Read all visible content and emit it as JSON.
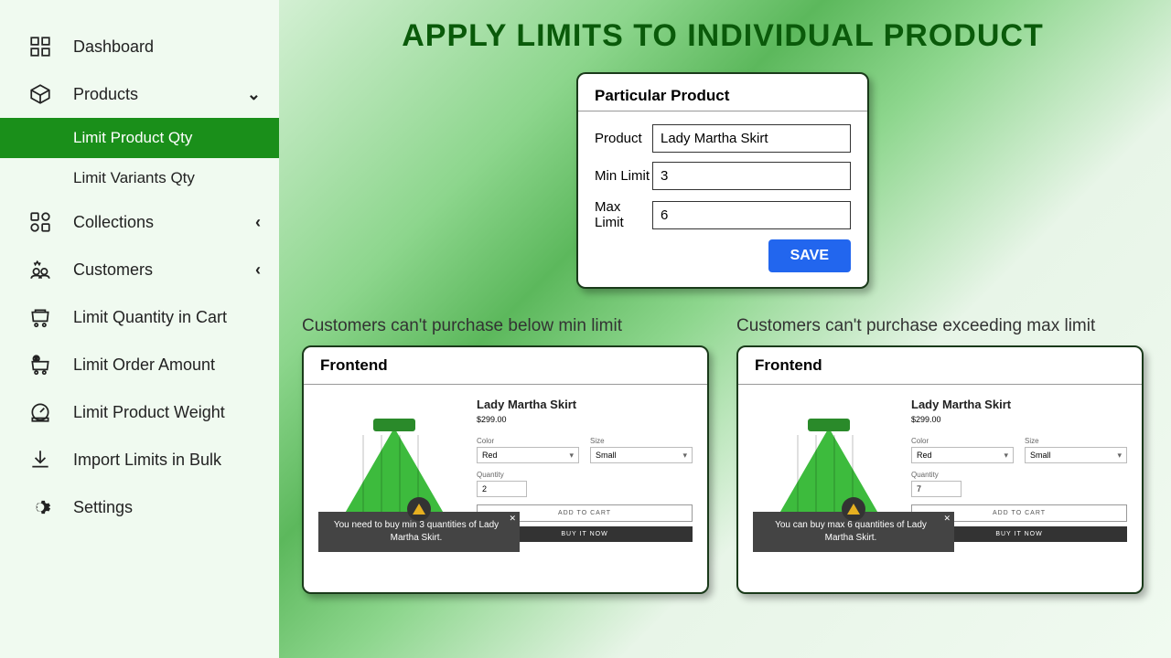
{
  "sidebar": {
    "items": [
      {
        "label": "Dashboard",
        "icon": "dashboard",
        "chev": ""
      },
      {
        "label": "Products",
        "icon": "products",
        "chev": "⌄"
      },
      {
        "label": "Collections",
        "icon": "collections",
        "chev": "‹"
      },
      {
        "label": "Customers",
        "icon": "customers",
        "chev": "‹"
      },
      {
        "label": "Limit Quantity in Cart",
        "icon": "cart",
        "chev": ""
      },
      {
        "label": "Limit Order Amount",
        "icon": "order-amount",
        "chev": ""
      },
      {
        "label": "Limit Product Weight",
        "icon": "weight",
        "chev": ""
      },
      {
        "label": "Import Limits in Bulk",
        "icon": "import",
        "chev": ""
      },
      {
        "label": "Settings",
        "icon": "settings",
        "chev": ""
      }
    ],
    "subitems": [
      {
        "label": "Limit Product Qty",
        "active": true
      },
      {
        "label": "Limit Variants Qty",
        "active": false
      }
    ]
  },
  "page": {
    "title": "APPLY LIMITS TO INDIVIDUAL PRODUCT"
  },
  "form": {
    "heading": "Particular Product",
    "product_label": "Product",
    "product_value": "Lady Martha Skirt",
    "min_label": "Min Limit",
    "min_value": "3",
    "max_label": "Max Limit",
    "max_value": "6",
    "save": "SAVE"
  },
  "previews": {
    "min": {
      "heading": "Customers can't purchase below min limit",
      "card_title": "Frontend",
      "product": "Lady Martha Skirt",
      "price": "$299.00",
      "color_label": "Color",
      "color_value": "Red",
      "size_label": "Size",
      "size_value": "Small",
      "qty_label": "Quantity",
      "qty_value": "2",
      "addcart": "ADD TO CART",
      "buynow": "BUY IT NOW",
      "toast": "You need to buy min 3 quantities of Lady Martha Skirt."
    },
    "max": {
      "heading": "Customers can't purchase exceeding max limit",
      "card_title": "Frontend",
      "product": "Lady Martha Skirt",
      "price": "$299.00",
      "color_label": "Color",
      "color_value": "Red",
      "size_label": "Size",
      "size_value": "Small",
      "qty_label": "Quantity",
      "qty_value": "7",
      "addcart": "ADD TO CART",
      "buynow": "BUY IT NOW",
      "toast": "You can buy max 6 quantities of Lady Martha Skirt."
    }
  }
}
